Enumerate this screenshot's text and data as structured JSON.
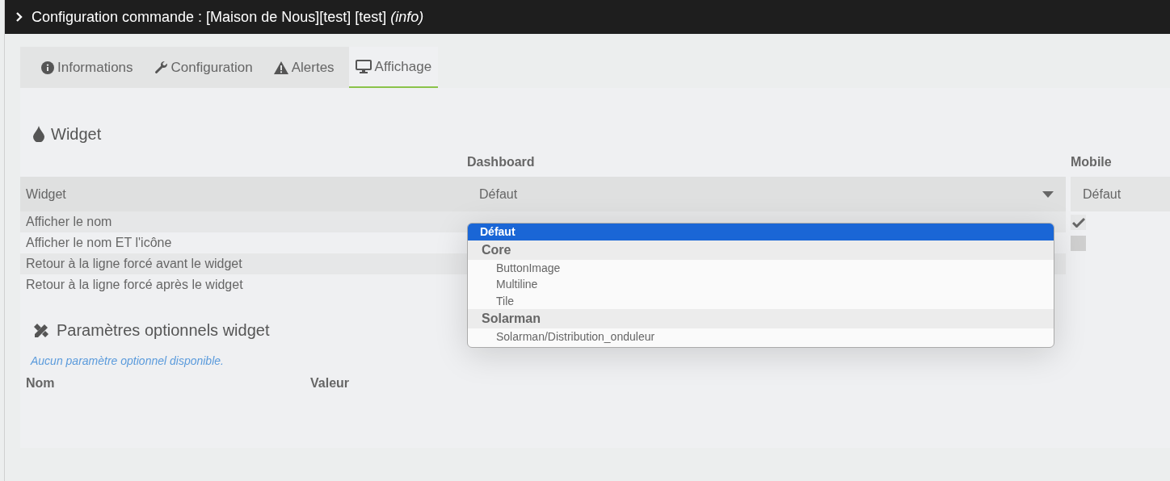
{
  "title": "Configuration commande : [Maison de Nous][test] [test] *(info)*",
  "tabs": [
    {
      "label": "Informations",
      "selected": false
    },
    {
      "label": "Configuration",
      "selected": false
    },
    {
      "label": "Alertes",
      "selected": false
    },
    {
      "label": "Affichage",
      "selected": true
    }
  ],
  "widget_section": {
    "title": "Widget",
    "columns": [
      "Dashboard",
      "Mobile"
    ],
    "rows": [
      {
        "label": "Widget",
        "kind": "select",
        "dashboard": "Défaut",
        "mobile": "Défaut"
      },
      {
        "label": "Afficher le nom",
        "kind": "checkbox",
        "mobile_checked": true
      },
      {
        "label": "Afficher le nom ET l'icône",
        "kind": "checkbox",
        "mobile_checked": false
      },
      {
        "label": "Retour à la ligne forcé avant le widget",
        "kind": "line"
      },
      {
        "label": "Retour à la ligne forcé après le widget",
        "kind": "line"
      }
    ],
    "dropdown": [
      {
        "label": "Défaut",
        "kind": "option",
        "selected": true
      },
      {
        "label": "Core",
        "kind": "group"
      },
      {
        "label": "ButtonImage",
        "kind": "option",
        "selected": false
      },
      {
        "label": "Multiline",
        "kind": "option",
        "selected": false
      },
      {
        "label": "Tile",
        "kind": "option",
        "selected": false
      },
      {
        "label": "Solarman",
        "kind": "group"
      },
      {
        "label": "Solarman/Distribution_onduleur",
        "kind": "option",
        "selected": false
      }
    ]
  },
  "optional_section": {
    "title": "Paramètres optionnels widget",
    "empty_message": "Aucun paramètre optionnel disponible.",
    "columns": [
      "Nom",
      "Valeur"
    ]
  }
}
